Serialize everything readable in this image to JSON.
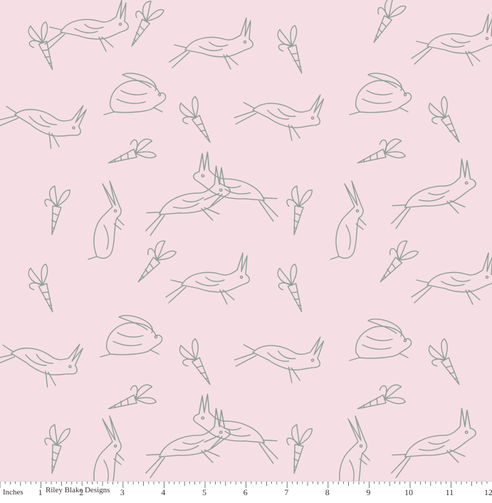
{
  "fabric": {
    "background_color": "#f5dfe4",
    "motif_color": "#8e9e98",
    "motifs": [
      "hare-leaping",
      "hare-crouching",
      "hare-standing",
      "carrot-bunch"
    ]
  },
  "ruler": {
    "unit_label": "Inches",
    "brand": "Riley Blake Designs",
    "numbers": [
      "1",
      "2",
      "3",
      "4",
      "5",
      "6",
      "7",
      "8",
      "9",
      "10",
      "11",
      "12"
    ]
  }
}
